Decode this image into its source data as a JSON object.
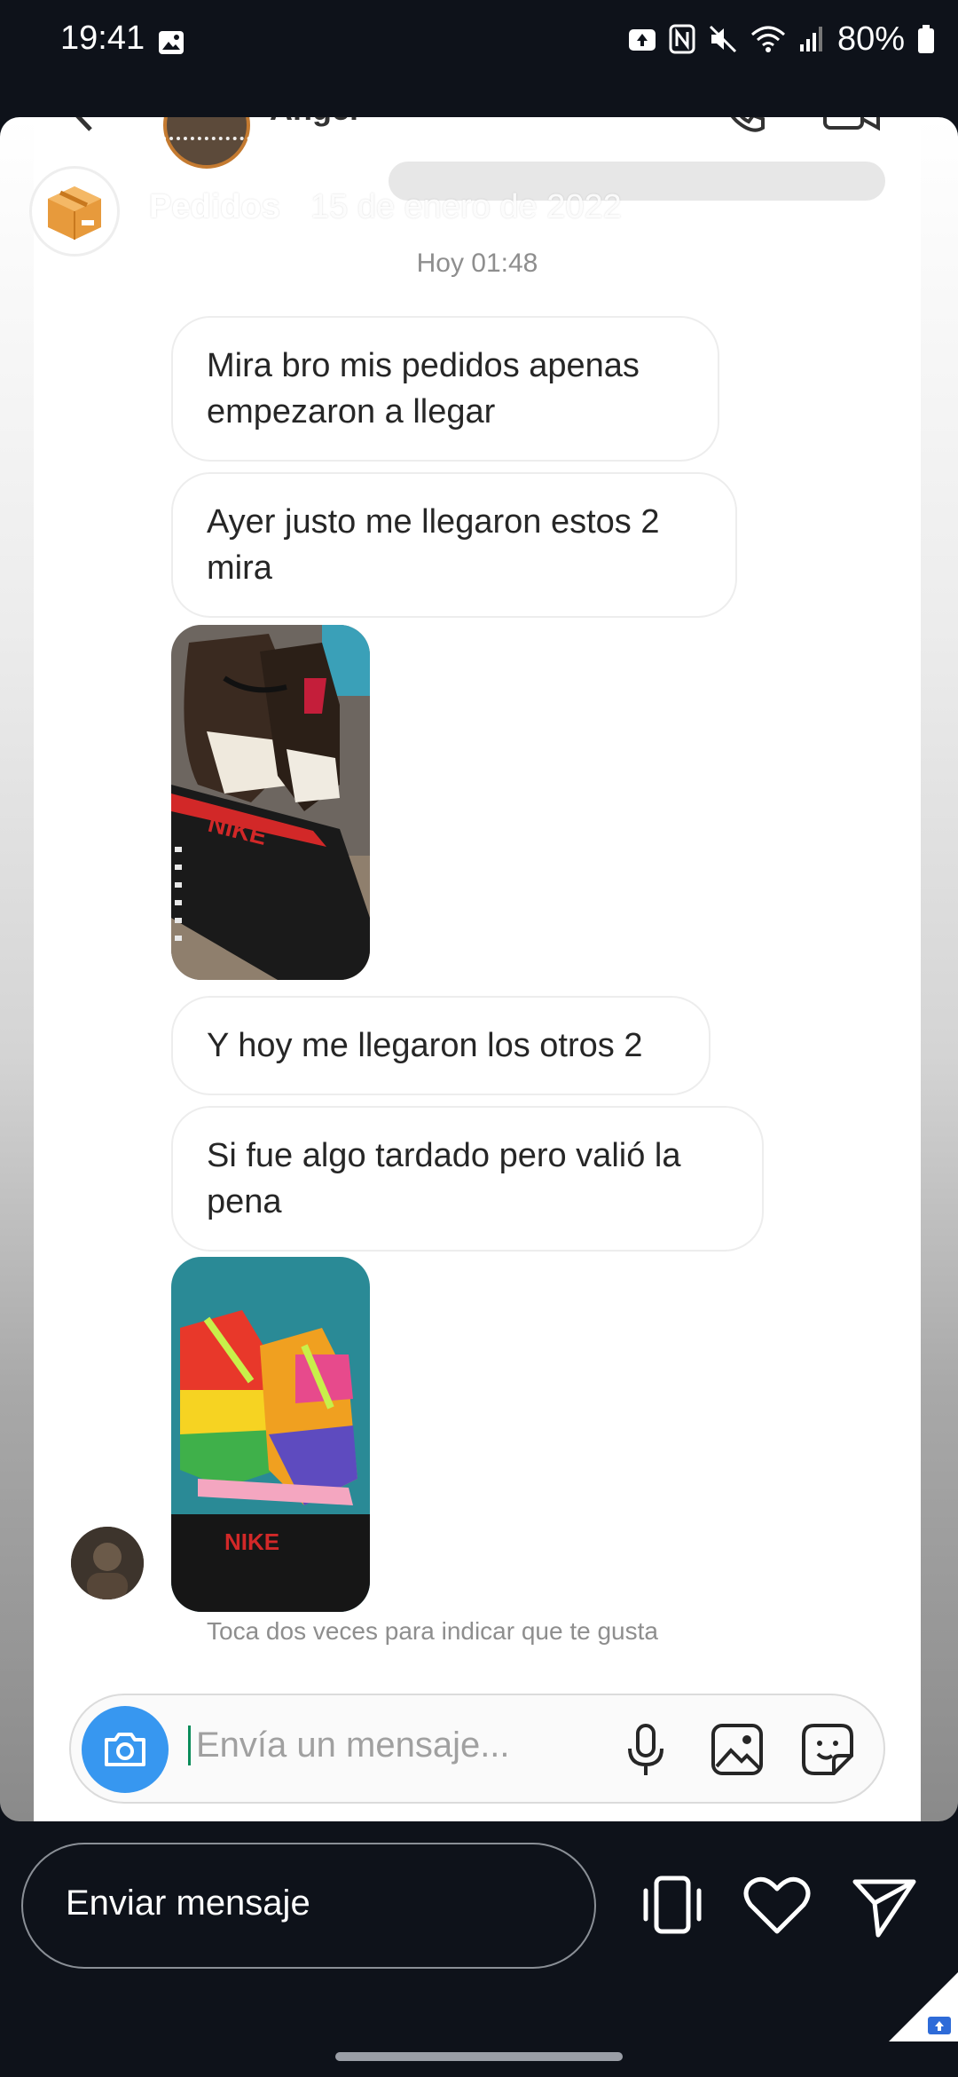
{
  "status_bar": {
    "time": "19:41",
    "battery": "80%",
    "icons": [
      "gallery-icon",
      "notification-icon",
      "nfc-icon",
      "mute-icon",
      "wifi-icon",
      "signal-icon",
      "battery-icon"
    ]
  },
  "story": {
    "title": "Pedidos",
    "date": "15 de enero de 2022"
  },
  "chat": {
    "header_name": "Angel",
    "timestamp": "Hoy 01:48",
    "messages": [
      "Mira bro mis pedidos apenas empezaron a llegar",
      "Ayer justo me llegaron estos 2 mira",
      "Y hoy me llegaron los otros 2",
      "Si fue algo tardado pero valió la pena"
    ],
    "hint": "Toca dos veces para indicar que te gusta",
    "composer_placeholder": "Envía un mensaje..."
  },
  "bottom_bar": {
    "reply_placeholder": "Enviar mensaje"
  },
  "colors": {
    "accent_blue": "#3797f0",
    "background": "#0e121a"
  }
}
